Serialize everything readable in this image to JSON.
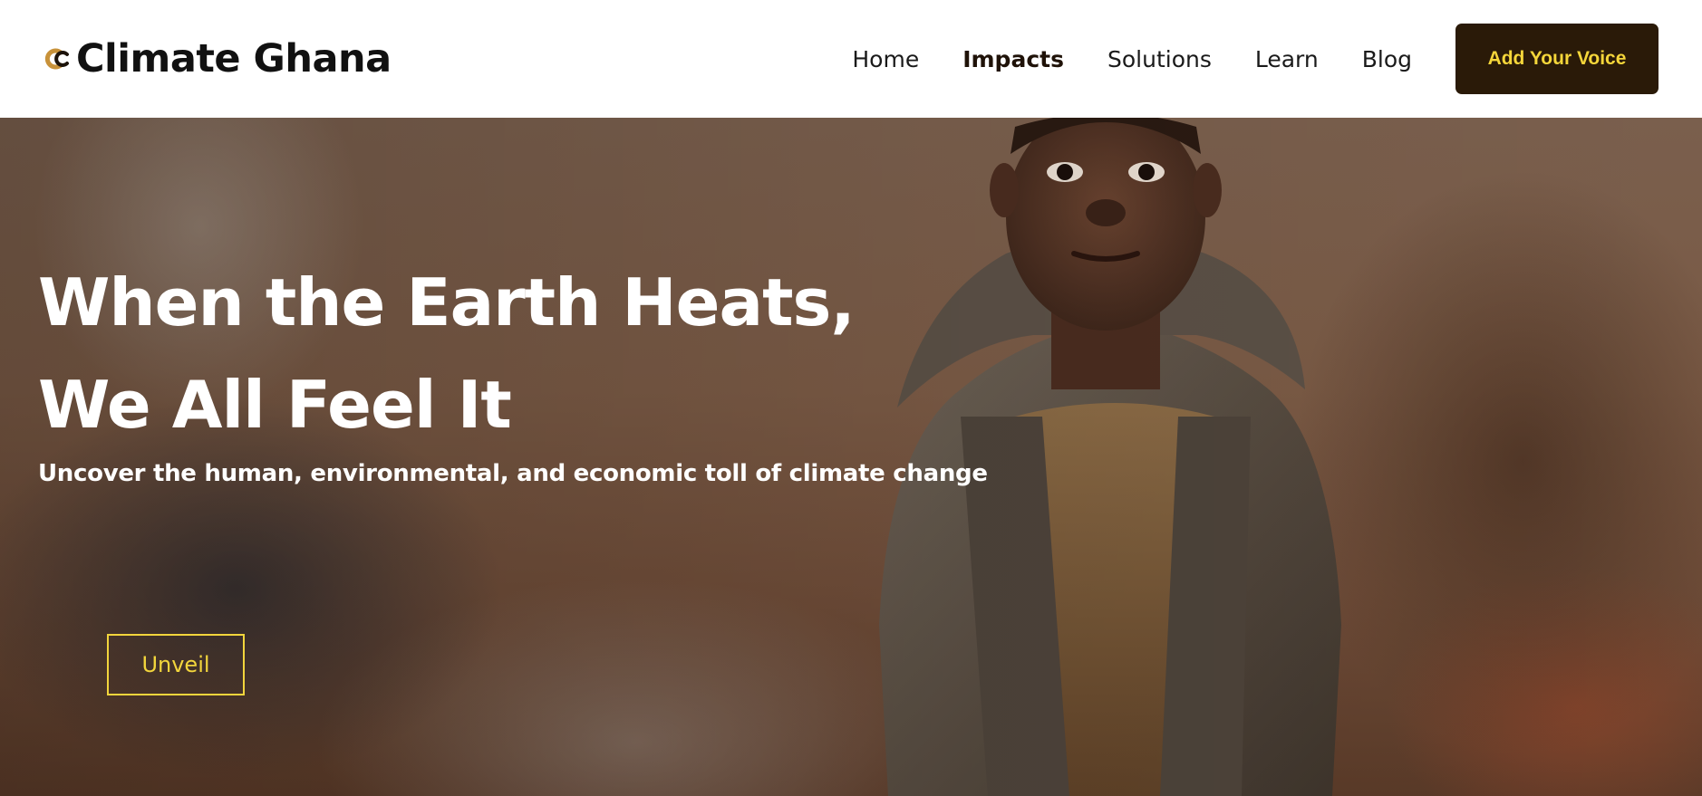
{
  "header": {
    "brand_name": "Climate Ghana",
    "logo_icon": "cc-logo-icon",
    "nav": [
      {
        "label": "Home",
        "active": false
      },
      {
        "label": "Impacts",
        "active": true
      },
      {
        "label": "Solutions",
        "active": false
      },
      {
        "label": "Learn",
        "active": false
      },
      {
        "label": "Blog",
        "active": false
      }
    ],
    "cta_label": "Add Your Voice"
  },
  "hero": {
    "title_line1": "When the Earth Heats,",
    "title_line2": "We All Feel It",
    "subtitle": "Uncover the human, environmental, and economic toll of climate change",
    "button_label": "Unveil"
  },
  "colors": {
    "cta_bg": "#2a1a08",
    "accent_yellow": "#f2d53c",
    "logo_gold": "#c8923a"
  }
}
